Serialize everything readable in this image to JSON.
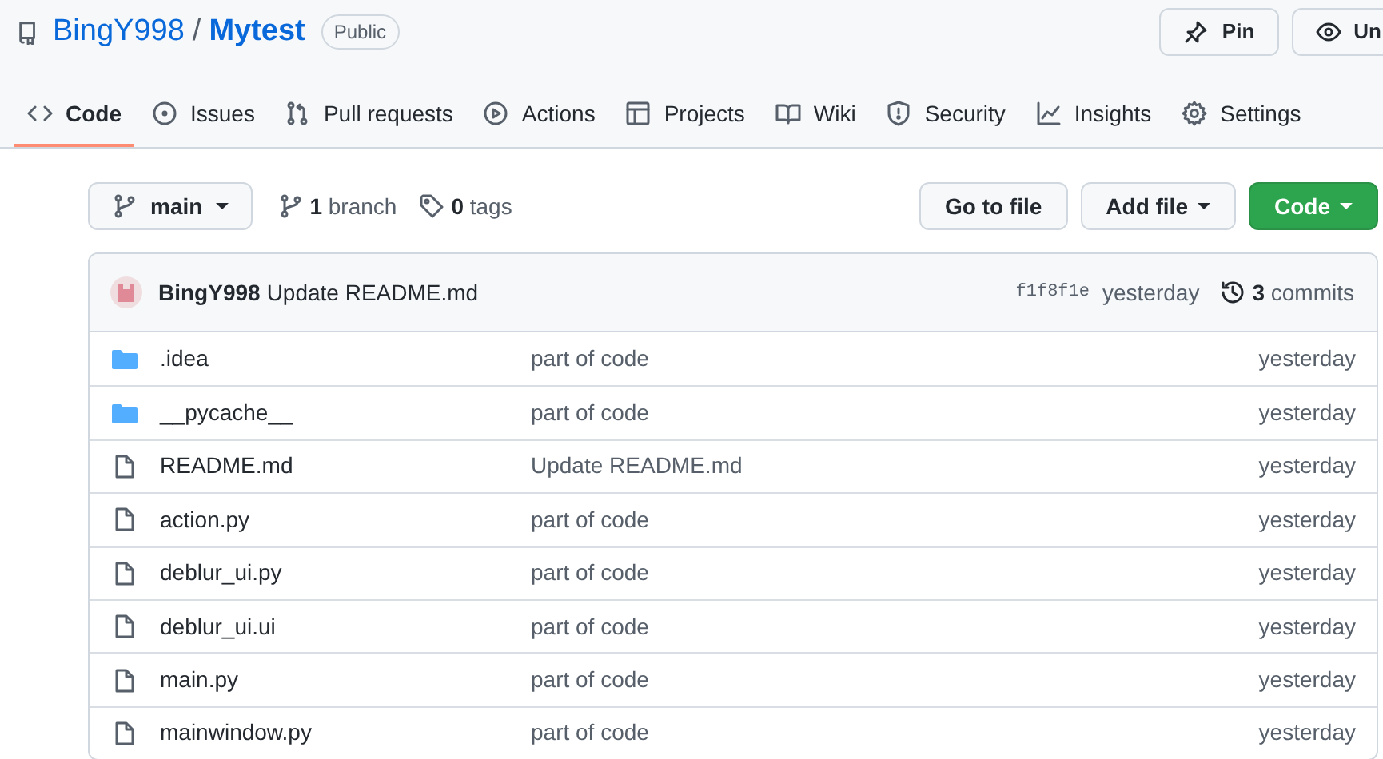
{
  "repo": {
    "owner": "BingY998",
    "separator": "/",
    "name": "Mytest",
    "visibility": "Public"
  },
  "header_buttons": [
    {
      "kind": "pin",
      "label": "Pin"
    },
    {
      "kind": "watch",
      "label": "Un"
    }
  ],
  "tabs": [
    {
      "kind": "code",
      "label": "Code",
      "selected": true
    },
    {
      "kind": "issues",
      "label": "Issues",
      "selected": false
    },
    {
      "kind": "pulls",
      "label": "Pull requests",
      "selected": false
    },
    {
      "kind": "actions",
      "label": "Actions",
      "selected": false
    },
    {
      "kind": "projects",
      "label": "Projects",
      "selected": false
    },
    {
      "kind": "wiki",
      "label": "Wiki",
      "selected": false
    },
    {
      "kind": "security",
      "label": "Security",
      "selected": false
    },
    {
      "kind": "insights",
      "label": "Insights",
      "selected": false
    },
    {
      "kind": "settings",
      "label": "Settings",
      "selected": false
    }
  ],
  "branch_select": "main",
  "branches": "**1** branch",
  "tags": "**0** tags",
  "actions": [
    {
      "kind": "plain",
      "label": "Go to file"
    },
    {
      "kind": "dropdown",
      "label": "Add file"
    },
    {
      "kind": "primary",
      "label": "Code"
    }
  ],
  "latest_commit": {
    "author": "BingY998",
    "message": "Update README.md",
    "sha": "f1f8f1e",
    "time": "yesterday",
    "commits": "**3** commits"
  },
  "files": [
    {
      "kind": "folder",
      "name": ".idea",
      "message": "part of code",
      "time": "yesterday"
    },
    {
      "kind": "folder",
      "name": "__pycache__",
      "message": "part of code",
      "time": "yesterday"
    },
    {
      "kind": "file",
      "name": "README.md",
      "message": "Update README.md",
      "time": "yesterday"
    },
    {
      "kind": "file",
      "name": "action.py",
      "message": "part of code",
      "time": "yesterday"
    },
    {
      "kind": "file",
      "name": "deblur_ui.py",
      "message": "part of code",
      "time": "yesterday"
    },
    {
      "kind": "file",
      "name": "deblur_ui.ui",
      "message": "part of code",
      "time": "yesterday"
    },
    {
      "kind": "file",
      "name": "main.py",
      "message": "part of code",
      "time": "yesterday"
    },
    {
      "kind": "file",
      "name": "mainwindow.py",
      "message": "part of code",
      "time": "yesterday"
    }
  ]
}
